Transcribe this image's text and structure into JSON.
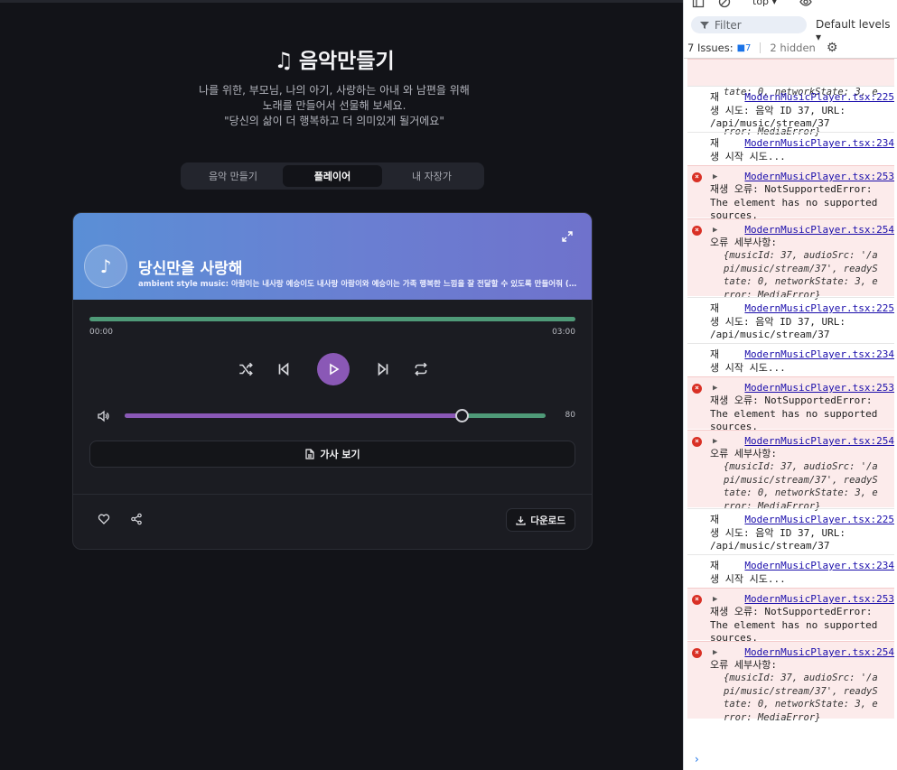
{
  "app": {
    "title": "음악만들기",
    "subtitle_lines": [
      "나를 위한, 부모님, 나의 아기, 사랑하는 아내 와 남편을 위해",
      "노래를 만들어서 선물해 보세요.",
      "\"당신의 삶이 더 행복하고 더 의미있게 될거에요\""
    ],
    "tabs": [
      "음악 만들기",
      "플레이어",
      "내 자장가"
    ],
    "active_tab": 1
  },
  "player": {
    "song_title": "당신만을 사랑해",
    "song_desc": "ambient style music: 아람이는 내사랑 예승이도 내사랑 아람이와 예승이는 가족 행복한 느낌을 잘 전달할 수 있도록 만들어줘 (아...",
    "current_time": "00:00",
    "duration": "03:00",
    "volume": 80,
    "volume_label": "80",
    "lyrics_label": "가사 보기",
    "download_label": "다운로드",
    "accent": "#8a58b6",
    "progress_color": "#4f9a78",
    "icons": [
      "music-note-icon",
      "expand-icon",
      "shuffle-icon",
      "skip-back-icon",
      "play-icon",
      "skip-forward-icon",
      "repeat-icon",
      "volume-icon",
      "document-icon",
      "heart-icon",
      "share-icon",
      "download-icon"
    ]
  },
  "devtools": {
    "context": "top ▾",
    "filter_placeholder": "Filter",
    "levels": "Default levels ▾",
    "issues_label": "7 Issues:",
    "issues_badge": "7",
    "hidden_label": "2 hidden",
    "first_obj_lines": [
      "tate: 0, networkState: 3, e",
      "rror: MediaError}"
    ],
    "logs": [
      {
        "type": "info",
        "link": "ModernMusicPlayer.tsx:225",
        "text": "재\n생 시도: 음악 ID 37, URL:\n/api/music/stream/37"
      },
      {
        "type": "info",
        "link": "ModernMusicPlayer.tsx:234",
        "text": "재\n생 시작 시도..."
      },
      {
        "type": "err",
        "link": "ModernMusicPlayer.tsx:253",
        "text": "재생 오류: NotSupportedError:\nThe element has no supported\nsources."
      },
      {
        "type": "errobj",
        "link": "ModernMusicPlayer.tsx:254",
        "text": "오류 세부사항:",
        "obj": [
          "{musicId: 37, audioSrc: '/a",
          "pi/music/stream/37', readyS",
          "tate: 0, networkState: 3, e",
          "rror: MediaError}"
        ]
      },
      {
        "type": "info",
        "link": "ModernMusicPlayer.tsx:225",
        "text": "재\n생 시도: 음악 ID 37, URL:\n/api/music/stream/37"
      },
      {
        "type": "info",
        "link": "ModernMusicPlayer.tsx:234",
        "text": "재\n생 시작 시도..."
      },
      {
        "type": "err",
        "link": "ModernMusicPlayer.tsx:253",
        "text": "재생 오류: NotSupportedError:\nThe element has no supported\nsources."
      },
      {
        "type": "errobj",
        "link": "ModernMusicPlayer.tsx:254",
        "text": "오류 세부사항:",
        "obj": [
          "{musicId: 37, audioSrc: '/a",
          "pi/music/stream/37', readyS",
          "tate: 0, networkState: 3, e",
          "rror: MediaError}"
        ]
      },
      {
        "type": "info",
        "link": "ModernMusicPlayer.tsx:225",
        "text": "재\n생 시도: 음악 ID 37, URL:\n/api/music/stream/37"
      },
      {
        "type": "info",
        "link": "ModernMusicPlayer.tsx:234",
        "text": "재\n생 시작 시도..."
      },
      {
        "type": "err",
        "link": "ModernMusicPlayer.tsx:253",
        "text": "재생 오류: NotSupportedError:\nThe element has no supported\nsources."
      },
      {
        "type": "errobj",
        "link": "ModernMusicPlayer.tsx:254",
        "text": "오류 세부사항:",
        "obj": [
          "{musicId: 37, audioSrc: '/a",
          "pi/music/stream/37', readyS",
          "tate: 0, networkState: 3, e",
          "rror: MediaError}"
        ]
      }
    ]
  }
}
